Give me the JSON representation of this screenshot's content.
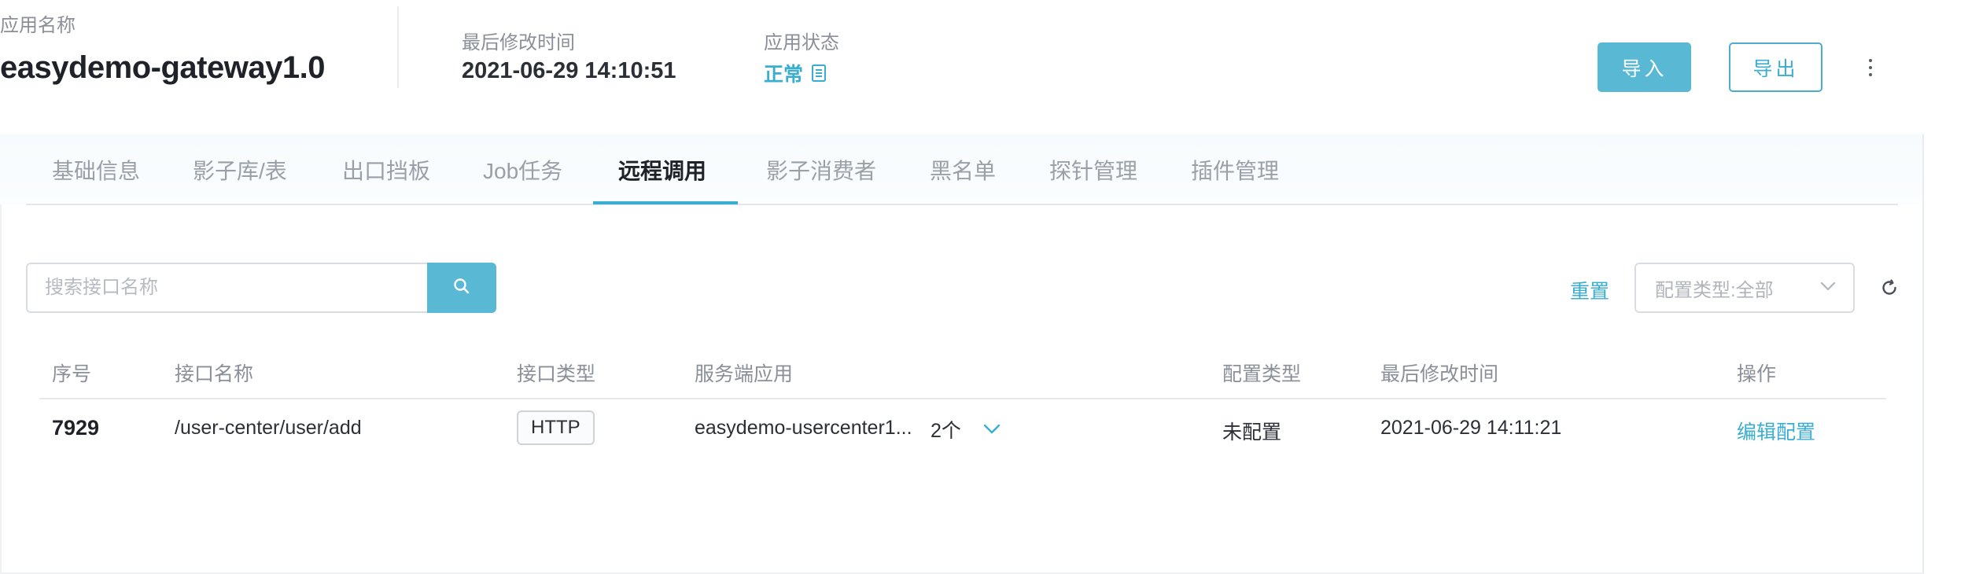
{
  "header": {
    "app_name_label": "应用名称",
    "app_name": "easydemo-gateway1.0",
    "last_modified_label": "最后修改时间",
    "last_modified_value": "2021-06-29 14:10:51",
    "status_label": "应用状态",
    "status_value": "正常",
    "status_icon": "document-icon",
    "import_label": "导入",
    "export_label": "导出",
    "more_icon": "more-vertical-icon"
  },
  "tabs": [
    {
      "label": "基础信息",
      "active": false
    },
    {
      "label": "影子库/表",
      "active": false
    },
    {
      "label": "出口挡板",
      "active": false
    },
    {
      "label": "Job任务",
      "active": false
    },
    {
      "label": "远程调用",
      "active": true
    },
    {
      "label": "影子消费者",
      "active": false
    },
    {
      "label": "黑名单",
      "active": false
    },
    {
      "label": "探针管理",
      "active": false
    },
    {
      "label": "插件管理",
      "active": false
    }
  ],
  "filters": {
    "search_placeholder": "搜索接口名称",
    "search_value": "",
    "search_icon": "search-icon",
    "reset_label": "重置",
    "config_type_select": "配置类型:全部",
    "refresh_icon": "refresh-icon"
  },
  "table": {
    "columns": [
      "序号",
      "接口名称",
      "接口类型",
      "服务端应用",
      "配置类型",
      "最后修改时间",
      "操作"
    ],
    "rows": [
      {
        "id": "7929",
        "interface_name": "/user-center/user/add",
        "interface_type": "HTTP",
        "server_app": "easydemo-usercenter1...",
        "server_app_count": "2个",
        "config_type": "未配置",
        "last_modified": "2021-06-29 14:11:21",
        "action": "编辑配置"
      }
    ]
  },
  "colors": {
    "accent": "#3aaed0",
    "primary_button": "#59b8d3",
    "tab_bar_bg": "#f6fbfd",
    "text_primary": "#1f2329",
    "text_secondary": "#8a8f99"
  }
}
